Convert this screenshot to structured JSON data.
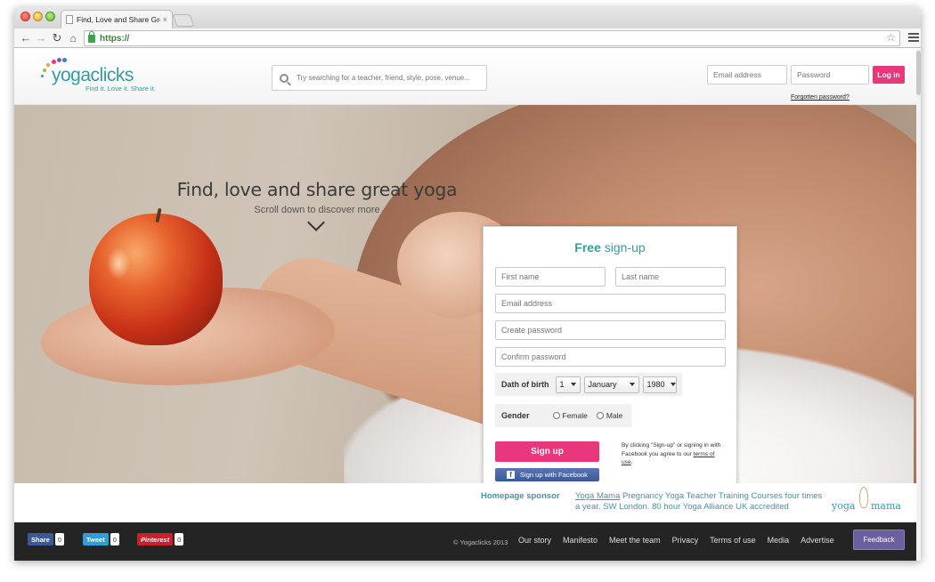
{
  "browser": {
    "tab_title": "Find, Love and Share Great",
    "tab_close": "×",
    "url_scheme": "https://",
    "url_rest": ""
  },
  "header": {
    "logo_word_yoga": "yoga",
    "logo_word_clicks": "clicks",
    "logo_tagline": "Find it. Love it. Share it.",
    "search_placeholder": "Try searching for a teacher, friend, style, pose, venue...",
    "email_placeholder": "Email address",
    "password_placeholder": "Password",
    "login_label": "Log in",
    "forgot_label": "Forgotten password?"
  },
  "hero": {
    "title": "Find, love and share great yoga",
    "subtitle": "Scroll down to discover more"
  },
  "signup": {
    "title_bold": "Free",
    "title_rest": " sign-up",
    "first_name_placeholder": "First name",
    "last_name_placeholder": "Last name",
    "email_placeholder": "Email address",
    "password_placeholder": "Create password",
    "confirm_placeholder": "Confirm password",
    "dob_label": "Dath of birth",
    "dob_day": "1",
    "dob_month": "January",
    "dob_year": "1980",
    "gender_label": "Gender",
    "gender_options": [
      "Female",
      "Male"
    ],
    "signup_label": "Sign up",
    "facebook_label": "Sign up with Facebook",
    "terms_text": "By clicking \"Sign-up\" or signing in with Facebook you agree to our",
    "terms_link": "terms of use",
    "terms_end": "."
  },
  "sponsor": {
    "label": "Homepage sponsor",
    "link_text": "Yoga Mama",
    "text": " Pregnancy Yoga Teacher Training Courses four times a year. SW London. 80 hour Yoga Alliance UK accredited",
    "logo_left": "yoga",
    "logo_right": "mama"
  },
  "footer": {
    "share_fb": "Share",
    "share_fb_count": "0",
    "share_tw": "Tweet",
    "share_tw_count": "0",
    "share_pin": "Pinterest",
    "share_pin_count": "0",
    "copyright": "© Yogaclicks 2013",
    "links": [
      "Our story",
      "Manifesto",
      "Meet the team",
      "Privacy",
      "Terms of use",
      "Media",
      "Advertise"
    ],
    "feedback_label": "Feedback"
  },
  "colors": {
    "brand_teal": "#3a9b9e",
    "brand_pink": "#e8377b",
    "facebook_blue": "#3b5998",
    "footer_bg": "#242424",
    "feedback_purple": "#6c5fa0"
  },
  "icons": [
    "page-icon",
    "back-icon",
    "forward-icon",
    "reload-icon",
    "home-icon",
    "lock-icon",
    "star-icon",
    "menu-icon",
    "search-icon",
    "chevron-down-icon",
    "facebook-icon"
  ]
}
